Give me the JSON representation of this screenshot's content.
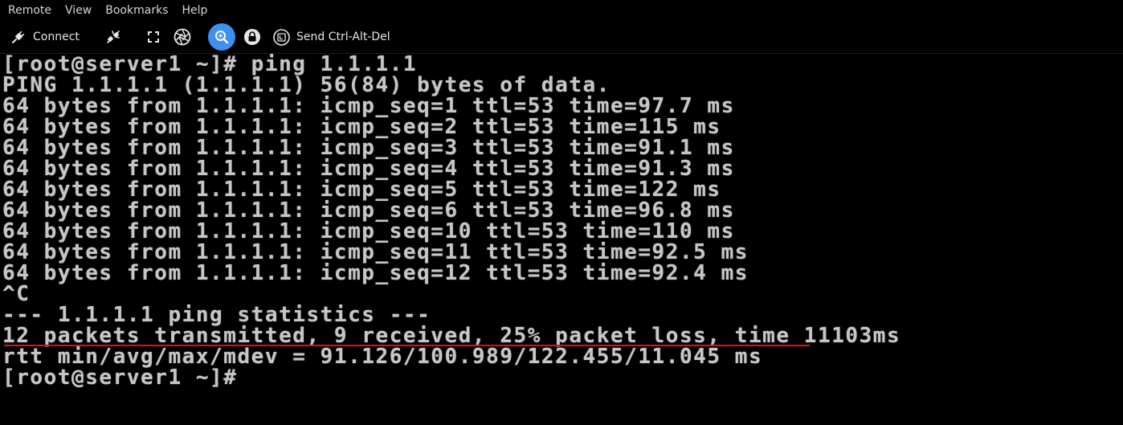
{
  "menu": {
    "items": [
      "Remote",
      "View",
      "Bookmarks",
      "Help"
    ]
  },
  "toolbar": {
    "connect_label": "Connect",
    "ctrl_alt_del_label": "Send Ctrl-Alt-Del",
    "icons": [
      "plug-icon",
      "disconnect-icon",
      "fullscreen-icon",
      "camera-shutter-icon",
      "zoom-icon",
      "lock-icon",
      "keyboard-key-icon"
    ],
    "accent_color": "#3d8ff0"
  },
  "terminal": {
    "lines": [
      "[root@server1 ~]# ping 1.1.1.1",
      "PING 1.1.1.1 (1.1.1.1) 56(84) bytes of data.",
      "64 bytes from 1.1.1.1: icmp_seq=1 ttl=53 time=97.7 ms",
      "64 bytes from 1.1.1.1: icmp_seq=2 ttl=53 time=115 ms",
      "64 bytes from 1.1.1.1: icmp_seq=3 ttl=53 time=91.1 ms",
      "64 bytes from 1.1.1.1: icmp_seq=4 ttl=53 time=91.3 ms",
      "64 bytes from 1.1.1.1: icmp_seq=5 ttl=53 time=122 ms",
      "64 bytes from 1.1.1.1: icmp_seq=6 ttl=53 time=96.8 ms",
      "64 bytes from 1.1.1.1: icmp_seq=10 ttl=53 time=110 ms",
      "64 bytes from 1.1.1.1: icmp_seq=11 ttl=53 time=92.5 ms",
      "64 bytes from 1.1.1.1: icmp_seq=12 ttl=53 time=92.4 ms",
      "^C",
      "--- 1.1.1.1 ping statistics ---",
      "12 packets transmitted, 9 received, 25% packet loss, time 11103ms",
      "rtt min/avg/max/mdev = 91.126/100.989/122.455/11.045 ms",
      "[root@server1 ~]#"
    ],
    "text_color": "#c6c6c6",
    "highlight_underline_color": "#d11818"
  }
}
